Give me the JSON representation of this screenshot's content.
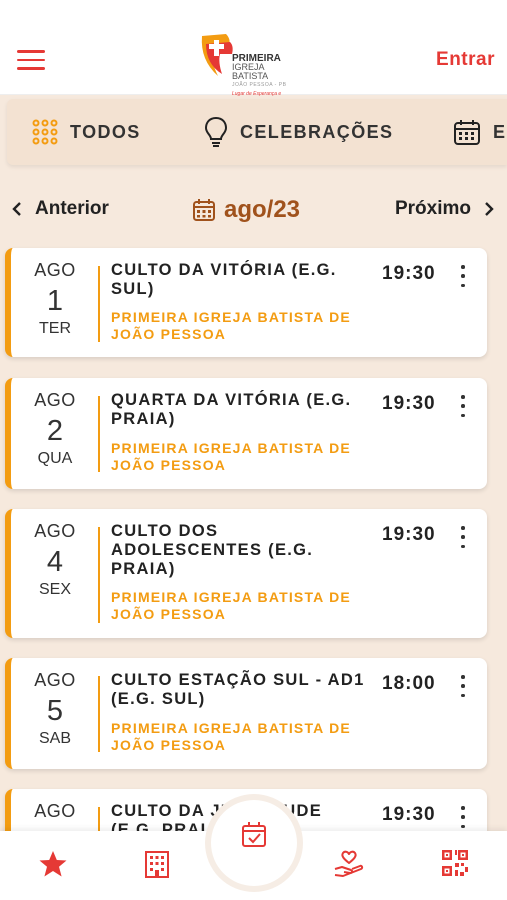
{
  "header": {
    "menu_icon": "hamburger-icon",
    "logo": {
      "line1": "PRIMEIRA",
      "line2": "IGREJA BATISTA",
      "line3": "JOÃO PESSOA - PB",
      "line4": "Lugar de Esperança e Vida"
    },
    "login_label": "Entrar"
  },
  "tabs": [
    {
      "label": "TODOS",
      "icon": "grid-dots-icon"
    },
    {
      "label": "CELEBRAÇÕES",
      "icon": "lightbulb-icon"
    },
    {
      "label": "E",
      "icon": "calendar-icon"
    }
  ],
  "month_nav": {
    "prev_label": "Anterior",
    "next_label": "Próximo",
    "current_month": "ago/23"
  },
  "events": [
    {
      "month": "AGO",
      "day": "1",
      "weekday": "TER",
      "title": "CULTO DA VITÓRIA (E.G. SUL)",
      "org": "PRIMEIRA IGREJA BATISTA DE JOÃO PESSOA",
      "time": "19:30"
    },
    {
      "month": "AGO",
      "day": "2",
      "weekday": "QUA",
      "title": "QUARTA DA VITÓRIA (E.G. PRAIA)",
      "org": "PRIMEIRA IGREJA BATISTA DE JOÃO PESSOA",
      "time": "19:30"
    },
    {
      "month": "AGO",
      "day": "4",
      "weekday": "SEX",
      "title": "CULTO DOS ADOLESCENTES (E.G. PRAIA)",
      "org": "PRIMEIRA IGREJA BATISTA DE JOÃO PESSOA",
      "time": "19:30"
    },
    {
      "month": "AGO",
      "day": "5",
      "weekday": "SAB",
      "title": "CULTO ESTAÇÃO SUL - AD1 (E.G. SUL)",
      "org": "PRIMEIRA IGREJA BATISTA DE JOÃO PESSOA",
      "time": "18:00"
    },
    {
      "month": "AGO",
      "day": "",
      "weekday": "",
      "title": "CULTO DA JUVENTUDE (E.G. PRAIA)",
      "org": "",
      "time": "19:30"
    }
  ],
  "bottom_nav": [
    {
      "icon": "star-icon"
    },
    {
      "icon": "building-icon"
    },
    {
      "icon": "calendar-check-icon"
    },
    {
      "icon": "hand-heart-icon"
    },
    {
      "icon": "qr-code-icon"
    }
  ],
  "colors": {
    "accent_red": "#e53935",
    "accent_orange": "#f39c12",
    "month_brown": "#a0521c",
    "background": "#f6e9dd"
  }
}
